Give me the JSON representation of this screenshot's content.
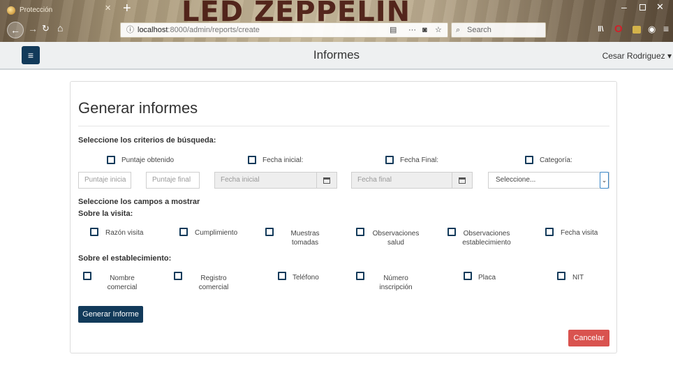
{
  "browser": {
    "tab_title": "Protección",
    "theme_text": "LED ZEPPELIN",
    "url_host": "localhost",
    "url_path": ":8000/admin/reports/create",
    "search_placeholder": "Search",
    "icons": [
      "site-icon",
      "close-icon",
      "plus-icon",
      "back-icon",
      "forward-icon",
      "reload-icon",
      "home-icon",
      "info-icon",
      "reader-icon",
      "more-icon",
      "pocket-icon",
      "star-icon",
      "search-icon",
      "library-icon",
      "opera-icon",
      "account-icon",
      "menu-icon"
    ]
  },
  "header": {
    "title": "Informes",
    "user": "Cesar Rodriguez",
    "caret": "▾",
    "brand_color": "#123a5a"
  },
  "form": {
    "title": "Generar informes",
    "criteria_heading": "Seleccione los criterios de búsqueda:",
    "criteria": [
      {
        "label": "Puntaje obtenido"
      },
      {
        "label": "Fecha inicial:"
      },
      {
        "label": "Fecha Final:"
      },
      {
        "label": "Categoría:"
      }
    ],
    "inputs": {
      "score_min_placeholder": "Puntaje inicia",
      "score_max_placeholder": "Puntaje final",
      "date_start_placeholder": "Fecha inicial",
      "date_end_placeholder": "Fecha final",
      "category_selected": "Seleccione..."
    },
    "fields_heading": "Seleccione los campos a mostrar",
    "visit_heading": "Sobre la visita:",
    "visit_fields": [
      {
        "line1": "Razón visita",
        "line2": ""
      },
      {
        "line1": "Cumplimiento",
        "line2": ""
      },
      {
        "line1": "Muestras",
        "line2": "tomadas"
      },
      {
        "line1": "Observaciones",
        "line2": "salud"
      },
      {
        "line1": "Observaciones",
        "line2": "establecimiento"
      },
      {
        "line1": "Fecha visita",
        "line2": ""
      }
    ],
    "establishment_heading": "Sobre el establecimiento:",
    "establishment_fields": [
      {
        "line1": "Nombre",
        "line2": "comercial"
      },
      {
        "line1": "Registro",
        "line2": "comercial"
      },
      {
        "line1": "Teléfono",
        "line2": ""
      },
      {
        "line1": "Número",
        "line2": "inscripción"
      },
      {
        "line1": "Placa",
        "line2": ""
      },
      {
        "line1": "NIT",
        "line2": ""
      }
    ],
    "generate_label": "Generar Informe",
    "cancel_label": "Cancelar",
    "cancel_color": "#d9534f"
  }
}
